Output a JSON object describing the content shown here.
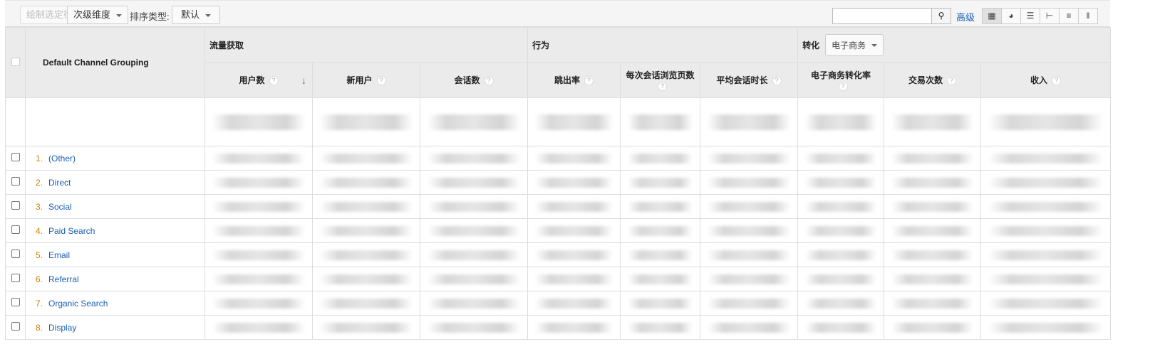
{
  "toolbar": {
    "plot_rows": "绘制选定行",
    "secondary_dimension": "次级维度",
    "sort_type_label": "排序类型:",
    "sort_type_value": "默认",
    "search_placeholder": "",
    "advanced": "高级"
  },
  "table": {
    "dimension_header": "Default Channel Grouping",
    "groups": {
      "acquisition": "流量获取",
      "behavior": "行为",
      "conversion": "转化",
      "conversion_select": "电子商务"
    },
    "metrics": [
      "用户数",
      "新用户",
      "会话数",
      "跳出率",
      "每次会话浏览页数",
      "平均会话时长",
      "电子商务转化率",
      "交易次数",
      "收入"
    ],
    "rows": [
      {
        "index": "1.",
        "channel": "(Other)"
      },
      {
        "index": "2.",
        "channel": "Direct"
      },
      {
        "index": "3.",
        "channel": "Social"
      },
      {
        "index": "4.",
        "channel": "Paid Search"
      },
      {
        "index": "5.",
        "channel": "Email"
      },
      {
        "index": "6.",
        "channel": "Referral"
      },
      {
        "index": "7.",
        "channel": "Organic Search"
      },
      {
        "index": "8.",
        "channel": "Display"
      }
    ]
  }
}
